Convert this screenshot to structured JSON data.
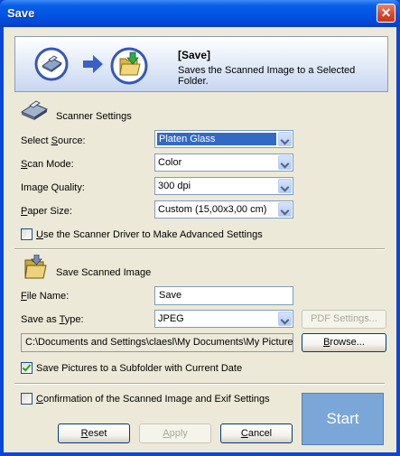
{
  "window": {
    "title": "Save",
    "close_glyph": "✕"
  },
  "banner": {
    "title": "[Save]",
    "subtitle": "Saves the Scanned Image to a Selected Folder.",
    "icons": [
      "scanner-circle-icon",
      "arrow-right-icon",
      "folder-save-circle-icon"
    ]
  },
  "scanner_settings": {
    "title": "Scanner Settings",
    "icon": "scanner-icon",
    "select_source": {
      "label_prefix": "Select ",
      "label_ul": "S",
      "label_rest": "ource:",
      "value": "Platen Glass"
    },
    "scan_mode": {
      "label_ul": "S",
      "label_rest": "can Mode:",
      "value": "Color"
    },
    "image_quality": {
      "label": "Image Quality:",
      "value": "300 dpi"
    },
    "paper_size": {
      "label_ul": "P",
      "label_rest": "aper Size:",
      "value": "Custom (15,00x3,00 cm)"
    },
    "advanced": {
      "label_ul": "U",
      "label_rest": "se the Scanner Driver to Make Advanced Settings",
      "checked": false
    }
  },
  "save_scanned": {
    "title": "Save Scanned Image",
    "icon": "folder-save-icon",
    "file_name": {
      "label_ul": "F",
      "label_rest": "ile Name:",
      "value": "Save"
    },
    "save_as_type": {
      "label_prefix": "Save as ",
      "label_ul": "T",
      "label_rest": "ype:",
      "value": "JPEG"
    },
    "pdf_settings_label": "PDF Settings...",
    "path_value": "C:\\Documents and Settings\\claesl\\My Documents\\My Pictures",
    "browse": {
      "label_ul": "B",
      "label_rest": "rowse..."
    },
    "subfolder": {
      "label": "Save Pictures to a Subfolder with Current Date",
      "checked": true
    }
  },
  "confirmation": {
    "label_ul": "C",
    "label_rest": "onfirmation of the Scanned Image and Exif Settings",
    "checked": false
  },
  "buttons": {
    "reset": {
      "label_ul": "R",
      "label_rest": "eset"
    },
    "apply": {
      "label_ul": "A",
      "label_rest": "pply"
    },
    "cancel": {
      "label_ul": "C",
      "label_rest": "ancel"
    },
    "start": "Start"
  },
  "colors": {
    "title_bar": "#0054e3",
    "dialog_bg": "#ece9d8",
    "selection": "#316ac5",
    "start_button": "#7aa7d8"
  }
}
